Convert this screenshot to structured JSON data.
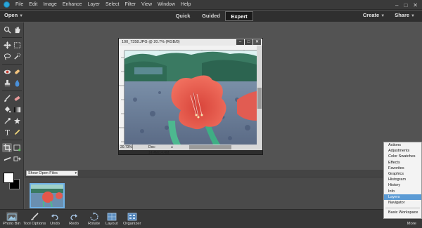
{
  "menubar": {
    "items": [
      "File",
      "Edit",
      "Image",
      "Enhance",
      "Layer",
      "Select",
      "Filter",
      "View",
      "Window",
      "Help"
    ],
    "controls": [
      "–",
      "□",
      "✕"
    ]
  },
  "modebar": {
    "open_label": "Open",
    "tabs": [
      {
        "label": "Quick",
        "active": false
      },
      {
        "label": "Guided",
        "active": false
      },
      {
        "label": "Expert",
        "active": true
      }
    ],
    "create_label": "Create",
    "share_label": "Share"
  },
  "toolbox": {
    "tools": [
      "zoom-icon",
      "hand-icon",
      "move-icon",
      "marquee-icon",
      "lasso-icon",
      "quick-select-icon",
      "red-eye-icon",
      "spot-healing-icon",
      "clone-stamp-icon",
      "blur-icon",
      "brush-icon",
      "eraser-icon",
      "paint-bucket-icon",
      "gradient-icon",
      "eyedropper-icon",
      "custom-shape-icon",
      "type-icon",
      "pencil-icon",
      "crop-icon",
      "recompose-icon",
      "straighten-icon",
      "content-aware-move-icon"
    ],
    "foreground_color": "#ffffff",
    "background_color": "#000000"
  },
  "document": {
    "title": "100_7358.JPG @ 20.7% (RGB/8)",
    "buttons": [
      "–",
      "□",
      "✕"
    ],
    "zoom": "20.73%",
    "info": "Doc: 14.4M/14.4M"
  },
  "panel_menu": {
    "items": [
      "Actions",
      "Adjustments",
      "Color Swatches",
      "Effects",
      "Favorites",
      "Graphics",
      "Histogram",
      "History",
      "Info",
      "Layers",
      "Navigator"
    ],
    "highlighted": "Layers",
    "footer": "Basic Workspace"
  },
  "photo_bin": {
    "select_value": "Show Open Files"
  },
  "taskbar": {
    "buttons": [
      {
        "label": "Photo Bin",
        "icon": "photo-bin-icon",
        "active": true
      },
      {
        "label": "Tool Options",
        "icon": "tool-options-icon",
        "active": false
      },
      {
        "label": "Undo",
        "icon": "undo-icon",
        "active": false
      },
      {
        "label": "Redo",
        "icon": "redo-icon",
        "active": false
      },
      {
        "label": "Rotate",
        "icon": "rotate-icon",
        "active": false
      },
      {
        "label": "Layout",
        "icon": "layout-icon",
        "active": false
      },
      {
        "label": "Organizer",
        "icon": "organizer-icon",
        "active": false
      }
    ],
    "more_label": "More"
  },
  "colors": {
    "accent": "#5b9bd5",
    "app_bg": "#535353",
    "bar_dark": "#2f2f2f"
  }
}
